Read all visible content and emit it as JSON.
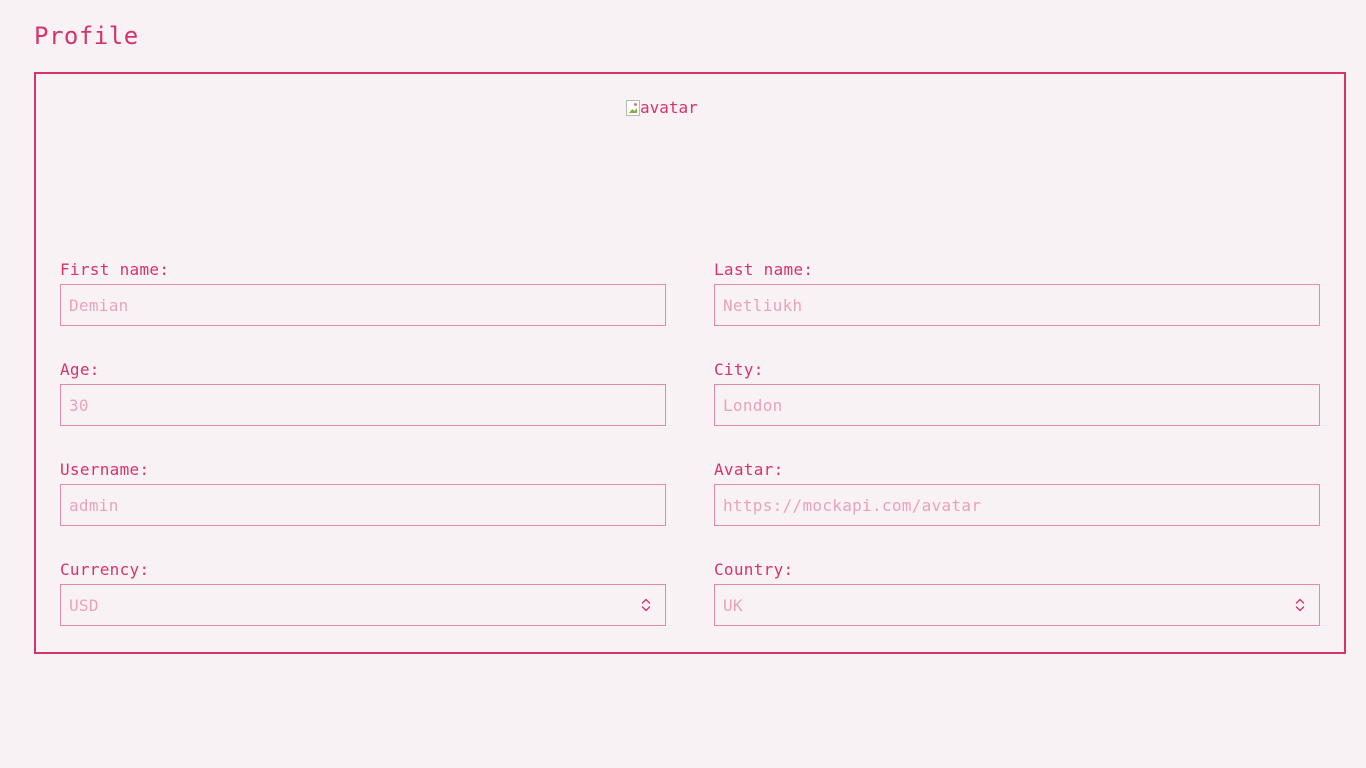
{
  "page": {
    "title": "Profile"
  },
  "avatar": {
    "alt_text": "avatar"
  },
  "form": {
    "first_name": {
      "label": "First name:",
      "value": "Demian"
    },
    "last_name": {
      "label": "Last name:",
      "value": "Netliukh"
    },
    "age": {
      "label": "Age:",
      "value": "30"
    },
    "city": {
      "label": "City:",
      "value": "London"
    },
    "username": {
      "label": "Username:",
      "value": "admin"
    },
    "avatar_url": {
      "label": "Avatar:",
      "value": "https://mockapi.com/avatar"
    },
    "currency": {
      "label": "Currency:",
      "selected": "USD"
    },
    "country": {
      "label": "Country:",
      "selected": "UK"
    }
  },
  "colors": {
    "accent": "#d6336c",
    "field_border": "#e28aa8",
    "field_text": "#e8a3bc",
    "background": "#f9f2f5"
  },
  "icons": {
    "avatar": "broken-image-icon",
    "select_arrow": "chevron-updown-icon"
  }
}
